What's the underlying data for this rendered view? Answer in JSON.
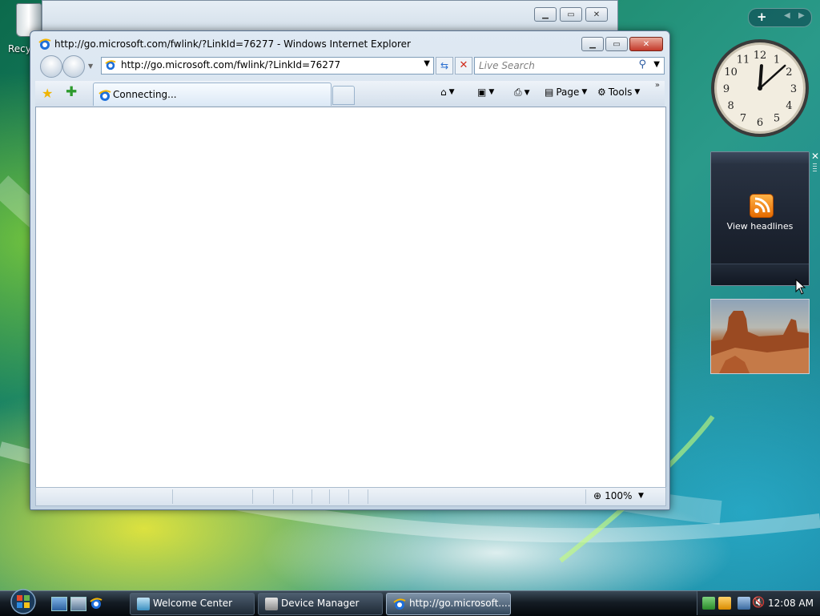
{
  "desktop": {
    "recycle_bin_label": "Recyc"
  },
  "background_window": {
    "minimize": "▁",
    "maximize": "▭",
    "close": "✕"
  },
  "ie": {
    "title": "http://go.microsoft.com/fwlink/?LinkId=76277 - Windows Internet Explorer",
    "window_buttons": {
      "minimize": "▁",
      "maximize": "▭",
      "close": "✕"
    },
    "address": {
      "url": "http://go.microsoft.com/fwlink/?LinkId=76277"
    },
    "search": {
      "placeholder": "Live Search"
    },
    "tab": {
      "label": "Connecting..."
    },
    "commands": {
      "page": "Page",
      "tools": "Tools"
    },
    "status": {
      "zoom": "100%"
    }
  },
  "sidebar": {
    "feeds": {
      "label": "View headlines"
    },
    "clock": {
      "hour": 12,
      "minute": 8,
      "numerals": [
        "12",
        "1",
        "2",
        "3",
        "4",
        "5",
        "6",
        "7",
        "8",
        "9",
        "10",
        "11"
      ]
    }
  },
  "taskbar": {
    "buttons": [
      {
        "label": "Welcome Center",
        "active": false
      },
      {
        "label": "Device Manager",
        "active": false
      },
      {
        "label": "http://go.microsoft....",
        "active": true
      }
    ],
    "clock": "12:08 AM"
  },
  "colors": {
    "accent_ie": "#1e6fd9",
    "rss": "#f07800",
    "close_red": "#c4392a"
  }
}
